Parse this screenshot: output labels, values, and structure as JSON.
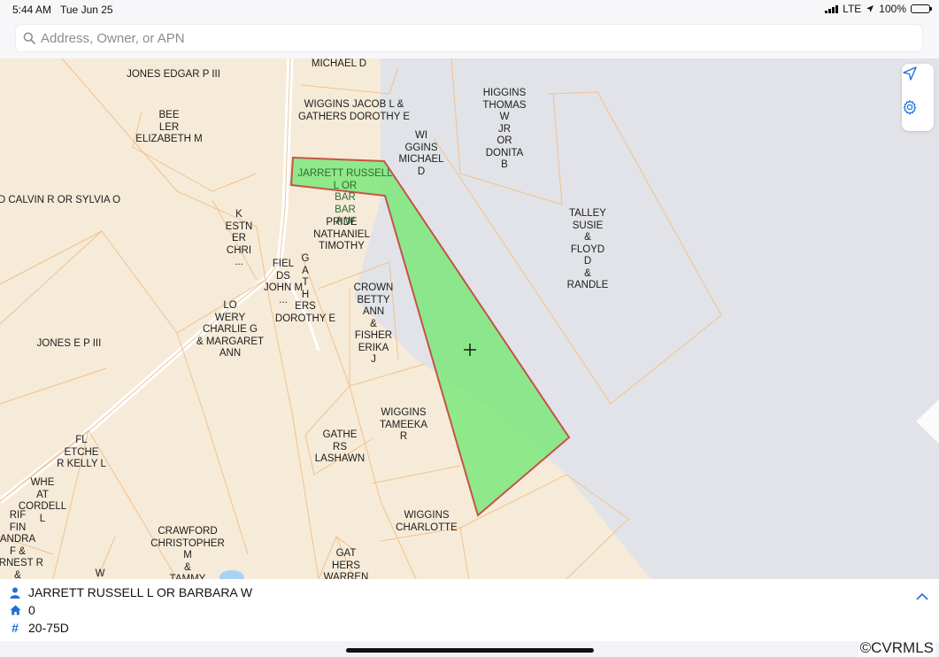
{
  "status_bar": {
    "time": "5:44 AM",
    "date": "Tue Jun 25",
    "network": "LTE",
    "battery": "100%",
    "battery_level": 1.0
  },
  "search": {
    "placeholder": "Address, Owner, or APN",
    "value": ""
  },
  "map": {
    "parcel_labels": [
      "MICHAEL D",
      "JONES EDGAR P III",
      "BEE\nLER\nELIZABETH M",
      "WIGGINS JACOB L &\nGATHERS DOROTHY E",
      "WI\nGGINS\nMICHAEL\nD",
      "HIGGINS\nTHOMAS\nW\nJR\nOR\nDONITA\nB",
      "JARRETT RUSSELL\nL OR\nBAR\nBAR\nA W",
      "D CALVIN R OR SYLVIA O",
      "K\nESTN\nER\nCHRI\n...",
      "PRIDE\nNATHANIEL\nTIMOTHY",
      "TALLEY\nSUSIE\n&\nFLOYD\nD\n&\nRANDLE",
      "FIEL\nDS\nJOHN M\n...",
      "G\nA\nT\nH\nERS\nDOROTHY E",
      "CROWN\nBETTY\nANN\n&\nFISHER\nERIKA\nJ",
      "LO\nWERY\nCHARLIE G\n& MARGARET\nANN",
      "JONES E P III",
      "WIGGINS\nTAMEEKA\nR",
      "GATHE\nRS\nLASHAWN",
      "FL\nETCHE\nR KELLY L",
      "WHE\nAT\nCORDELL\nL",
      "WIGGINS\nCHARLOTTE",
      "RIF\nFIN\nANDRA\nF &\nERNEST R\n&",
      "CRAWFORD\nCHRISTOPHER\nM\n&\nTAMMY",
      "GAT\nHERS\nWARREN",
      "W"
    ],
    "colors": {
      "land": "#f6ebd8",
      "water": "#e1e3e8",
      "parcel_line": "#f2c08e",
      "selected_fill": "#7ee87c",
      "selected_outline": "#c0392b"
    },
    "tools": [
      "location-arrow-icon",
      "gear-icon"
    ]
  },
  "info": {
    "owner": "JARRETT RUSSELL L OR BARBARA W",
    "address_number": "0",
    "parcel_id": "20-75D"
  },
  "footer": {
    "copyright": "©CVRMLS"
  }
}
